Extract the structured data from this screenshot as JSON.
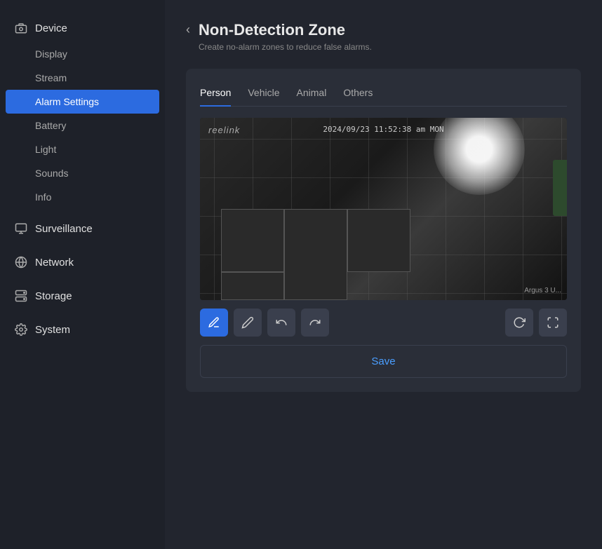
{
  "sidebar": {
    "sections": [
      {
        "id": "device",
        "label": "Device",
        "icon": "📷",
        "items": [
          {
            "id": "display",
            "label": "Display",
            "active": false
          },
          {
            "id": "stream",
            "label": "Stream",
            "active": false
          },
          {
            "id": "alarm-settings",
            "label": "Alarm Settings",
            "active": true
          },
          {
            "id": "battery",
            "label": "Battery",
            "active": false
          },
          {
            "id": "light",
            "label": "Light",
            "active": false
          },
          {
            "id": "sounds",
            "label": "Sounds",
            "active": false
          },
          {
            "id": "info",
            "label": "Info",
            "active": false
          }
        ]
      },
      {
        "id": "surveillance",
        "label": "Surveillance",
        "icon": "🖥",
        "items": []
      },
      {
        "id": "network",
        "label": "Network",
        "icon": "🌐",
        "items": []
      },
      {
        "id": "storage",
        "label": "Storage",
        "icon": "💾",
        "items": []
      },
      {
        "id": "system",
        "label": "System",
        "icon": "⚙",
        "items": []
      }
    ]
  },
  "page": {
    "title": "Non-Detection Zone",
    "subtitle": "Create no-alarm zones to reduce false alarms.",
    "back_label": "‹"
  },
  "tabs": [
    {
      "id": "person",
      "label": "Person",
      "active": true
    },
    {
      "id": "vehicle",
      "label": "Vehicle",
      "active": false
    },
    {
      "id": "animal",
      "label": "Animal",
      "active": false
    },
    {
      "id": "others",
      "label": "Others",
      "active": false
    }
  ],
  "camera": {
    "logo": "reelink",
    "timestamp": "2024/09/23 11:52:38 am MON",
    "brand": "Argus 3 U..."
  },
  "toolbar": {
    "tools": [
      {
        "id": "draw",
        "label": "✏",
        "active": true
      },
      {
        "id": "pen",
        "label": "🖊",
        "active": false
      },
      {
        "id": "undo",
        "label": "↩",
        "active": false
      },
      {
        "id": "redo",
        "label": "↪",
        "active": false
      }
    ],
    "reset_label": "↺",
    "fullscreen_label": "⛶"
  },
  "save_button": {
    "label": "Save"
  }
}
